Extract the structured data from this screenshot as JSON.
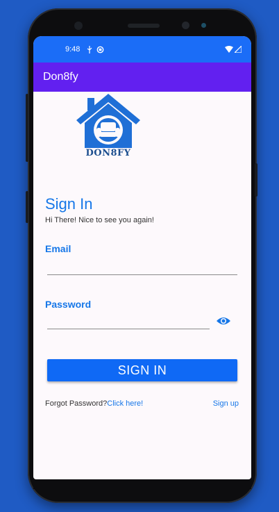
{
  "status_bar": {
    "time": "9:48",
    "left_icons": [
      "usb-icon",
      "sync-icon"
    ],
    "right_icons": [
      "wifi-icon",
      "signal-icon"
    ]
  },
  "app_bar": {
    "title": "Don8fy"
  },
  "logo": {
    "icon": "house-sofa-logo",
    "text": "DON8FY"
  },
  "sign_in": {
    "title": "Sign In",
    "subtitle": "Hi There! Nice to see you again!"
  },
  "form": {
    "email_label": "Email",
    "email_value": "",
    "password_label": "Password",
    "password_value": "",
    "password_toggle_icon": "eye-icon"
  },
  "actions": {
    "sign_in_button": "SIGN IN",
    "forgot_text": "Forgot Password?",
    "forgot_link": "Click here!",
    "sign_up_link": "Sign up"
  },
  "colors": {
    "background": "#1f5bc4",
    "status_bar": "#1b6df7",
    "app_bar": "#6220f0",
    "accent": "#1677e8",
    "button": "#0f69f5"
  }
}
